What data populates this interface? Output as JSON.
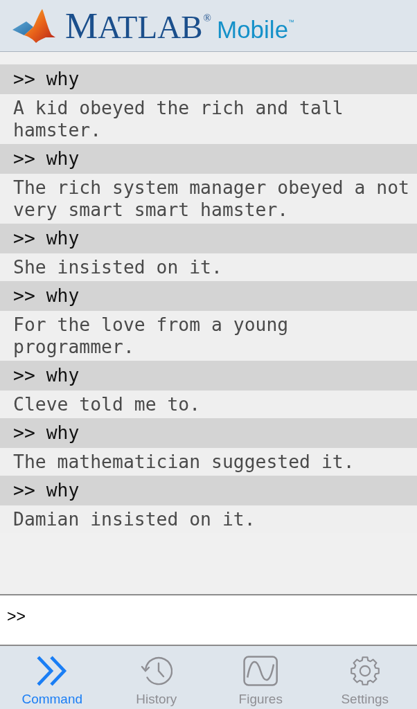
{
  "header": {
    "brand": "MATLAB$^{®}$",
    "product": "Mobile$^{™}$"
  },
  "session": [
    {
      "command": ">> why",
      "output": "A kid obeyed the rich and tall hamster."
    },
    {
      "command": ">> why",
      "output": "The rich system manager obeyed a not very smart smart hamster."
    },
    {
      "command": ">> why",
      "output": "She insisted on it."
    },
    {
      "command": ">> why",
      "output": "For the love from a young programmer."
    },
    {
      "command": ">> why",
      "output": "Cleve told me to."
    },
    {
      "command": ">> why",
      "output": "The mathematician suggested it."
    },
    {
      "command": ">> why",
      "output": "Damian insisted on it."
    }
  ],
  "input": {
    "prompt": ">>"
  },
  "tabs": [
    {
      "kind": "command",
      "label": "Command",
      "selected": true
    },
    {
      "kind": "history",
      "label": "History",
      "selected": false
    },
    {
      "kind": "figures",
      "label": "Figures",
      "selected": false
    },
    {
      "kind": "settings",
      "label": "Settings",
      "selected": false
    }
  ]
}
